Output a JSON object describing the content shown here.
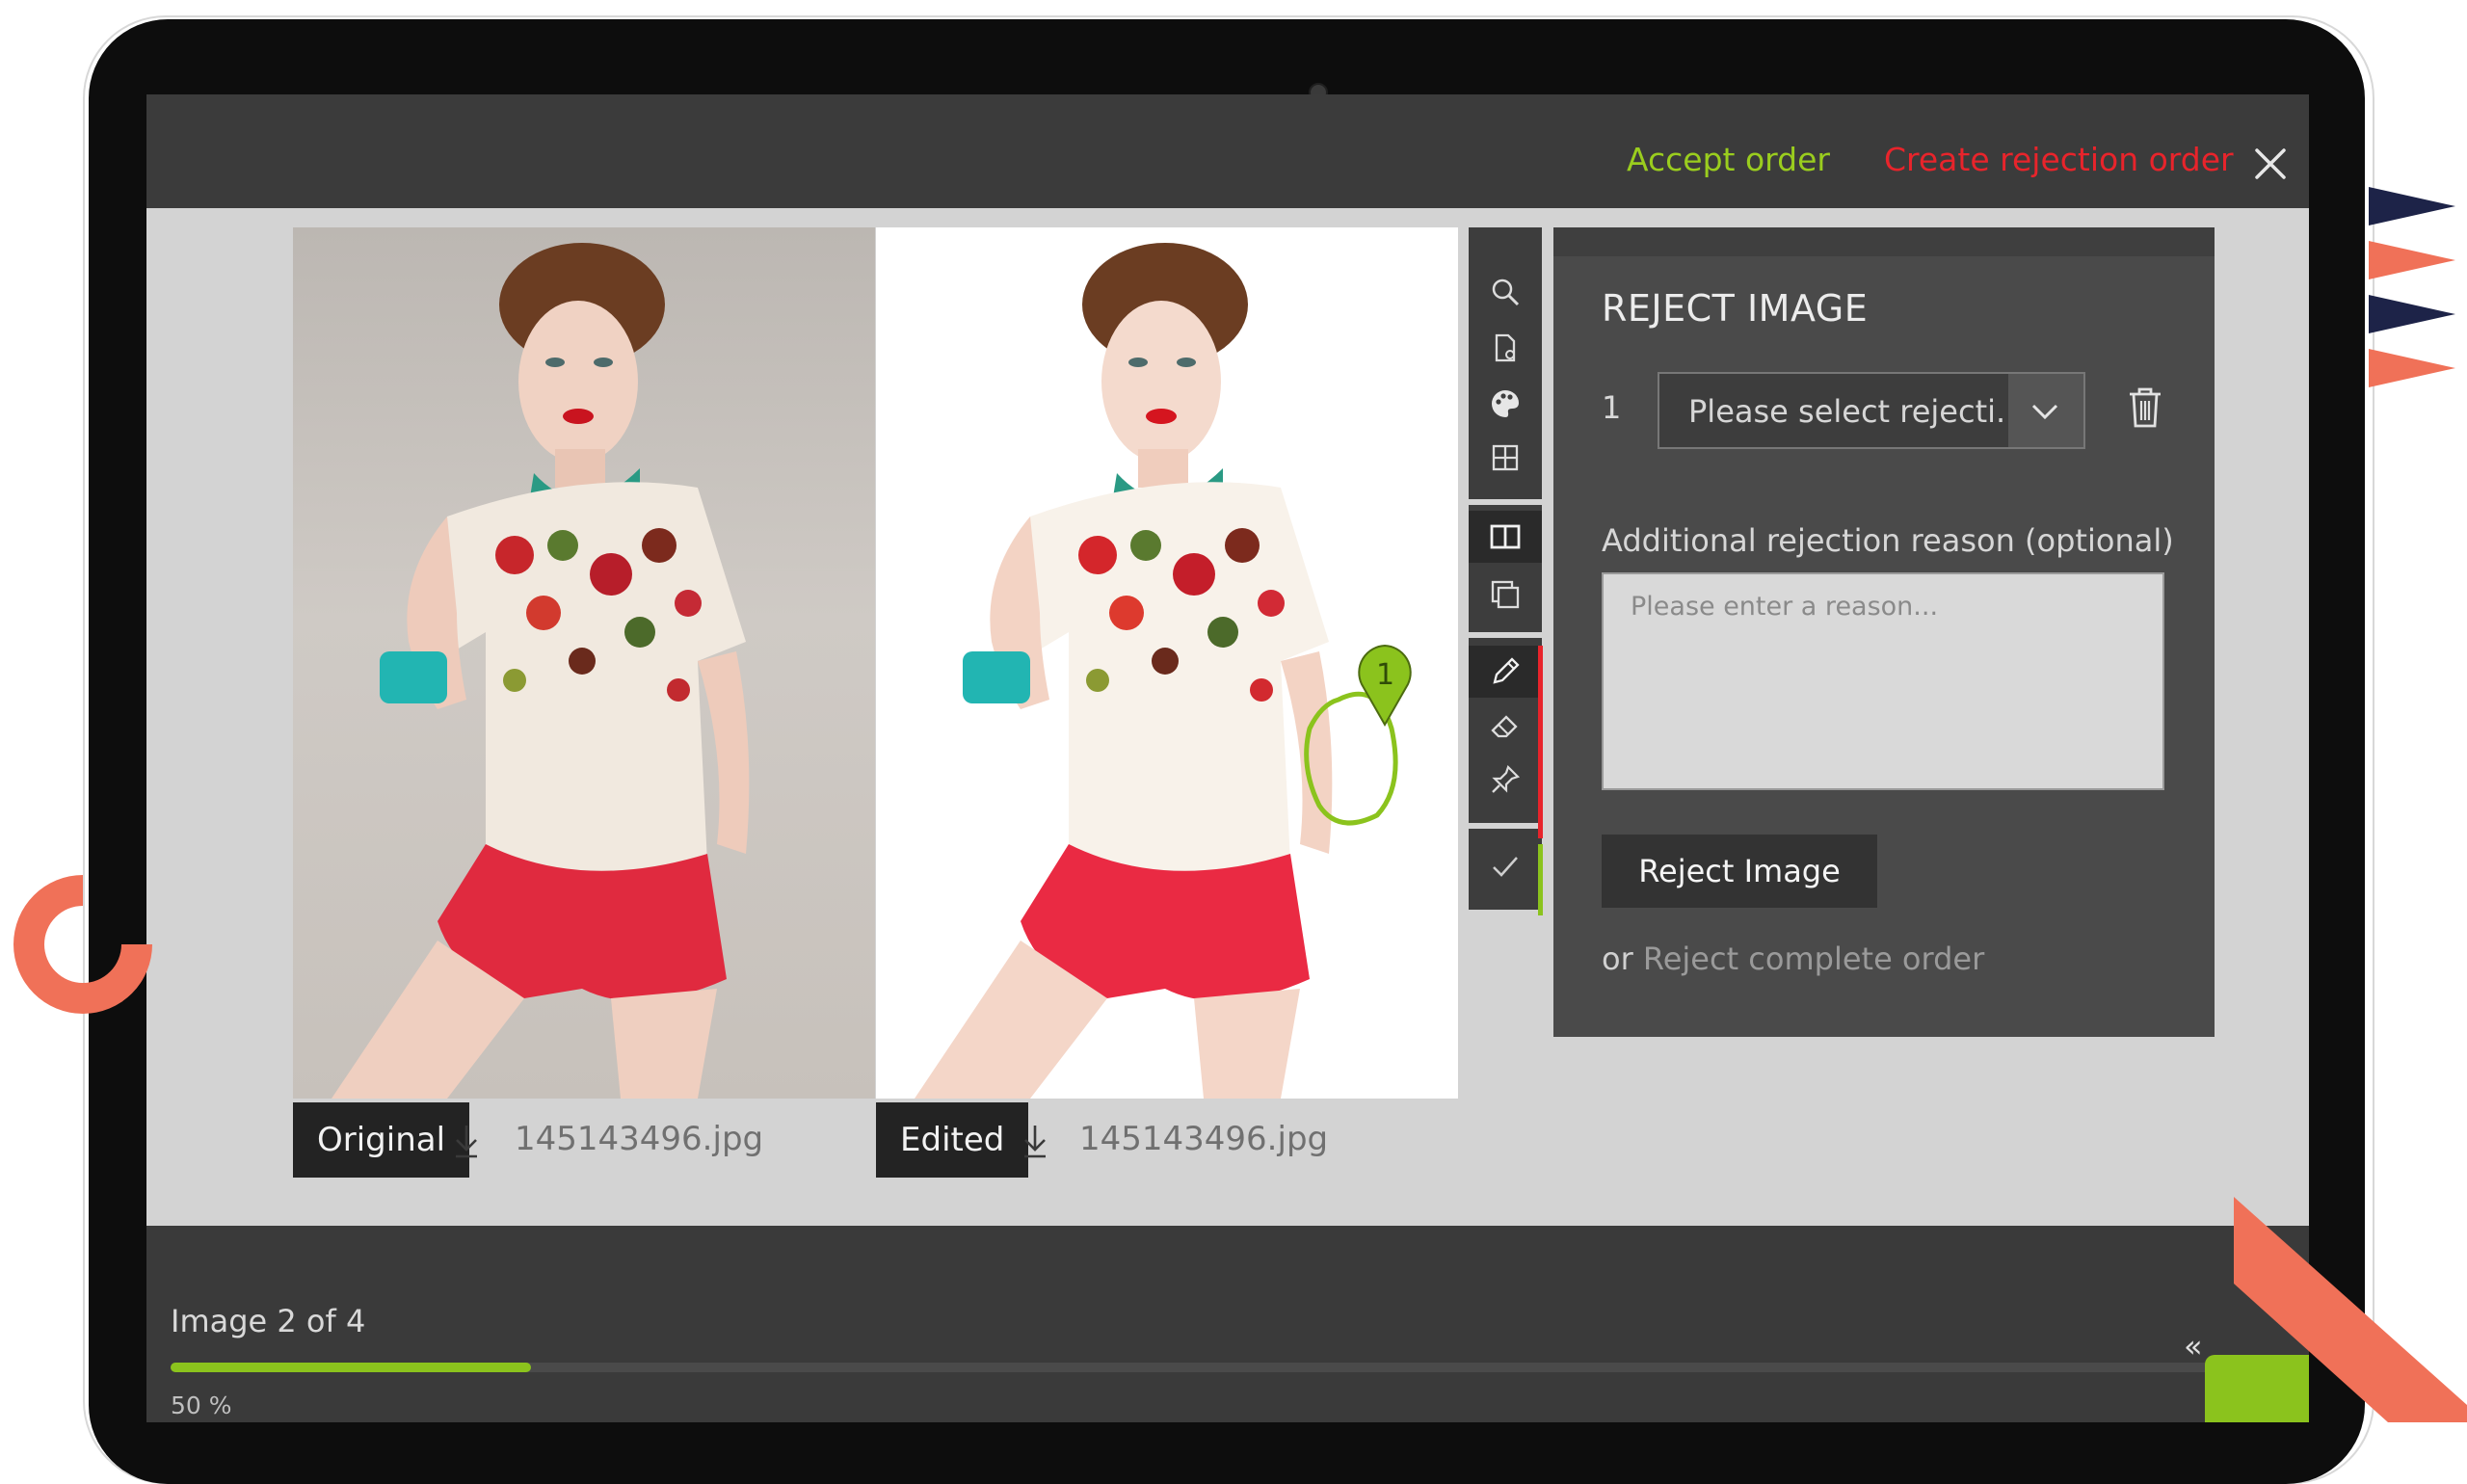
{
  "header": {
    "accept_label": "Accept order",
    "reject_order_label": "Create rejection order",
    "close_icon": "close-icon"
  },
  "images": {
    "original": {
      "label": "Original",
      "filename": "145143496.jpg"
    },
    "edited": {
      "label": "Edited",
      "filename": "145143496.jpg",
      "marker_number": "1"
    }
  },
  "tools": [
    {
      "icon": "zoom-icon"
    },
    {
      "icon": "document-search-icon"
    },
    {
      "icon": "palette-icon"
    },
    {
      "icon": "grid-icon"
    },
    {
      "icon": "split-view-icon",
      "active": true
    },
    {
      "icon": "overlay-view-icon"
    },
    {
      "icon": "pencil-icon",
      "active": true
    },
    {
      "icon": "eraser-icon"
    },
    {
      "icon": "pin-icon"
    },
    {
      "icon": "check-icon"
    }
  ],
  "panel": {
    "title": "REJECT IMAGE",
    "row_number": "1",
    "select_placeholder": "Please select rejecti...",
    "additional_label": "Additional rejection reason (optional)",
    "textarea_placeholder": "Please enter a reason...",
    "reject_button": "Reject Image",
    "or_text": "or",
    "reject_complete_link": "Reject complete order"
  },
  "footer": {
    "image_count": "Image 2 of 4",
    "progress_percent": 50,
    "progress_label": "50 %",
    "nav_arrows": "«"
  },
  "colors": {
    "accent_green": "#8bc31d",
    "reject_red": "#e8242b",
    "dark_bar": "#3b3b3b",
    "workspace": "#d3d3d3"
  }
}
